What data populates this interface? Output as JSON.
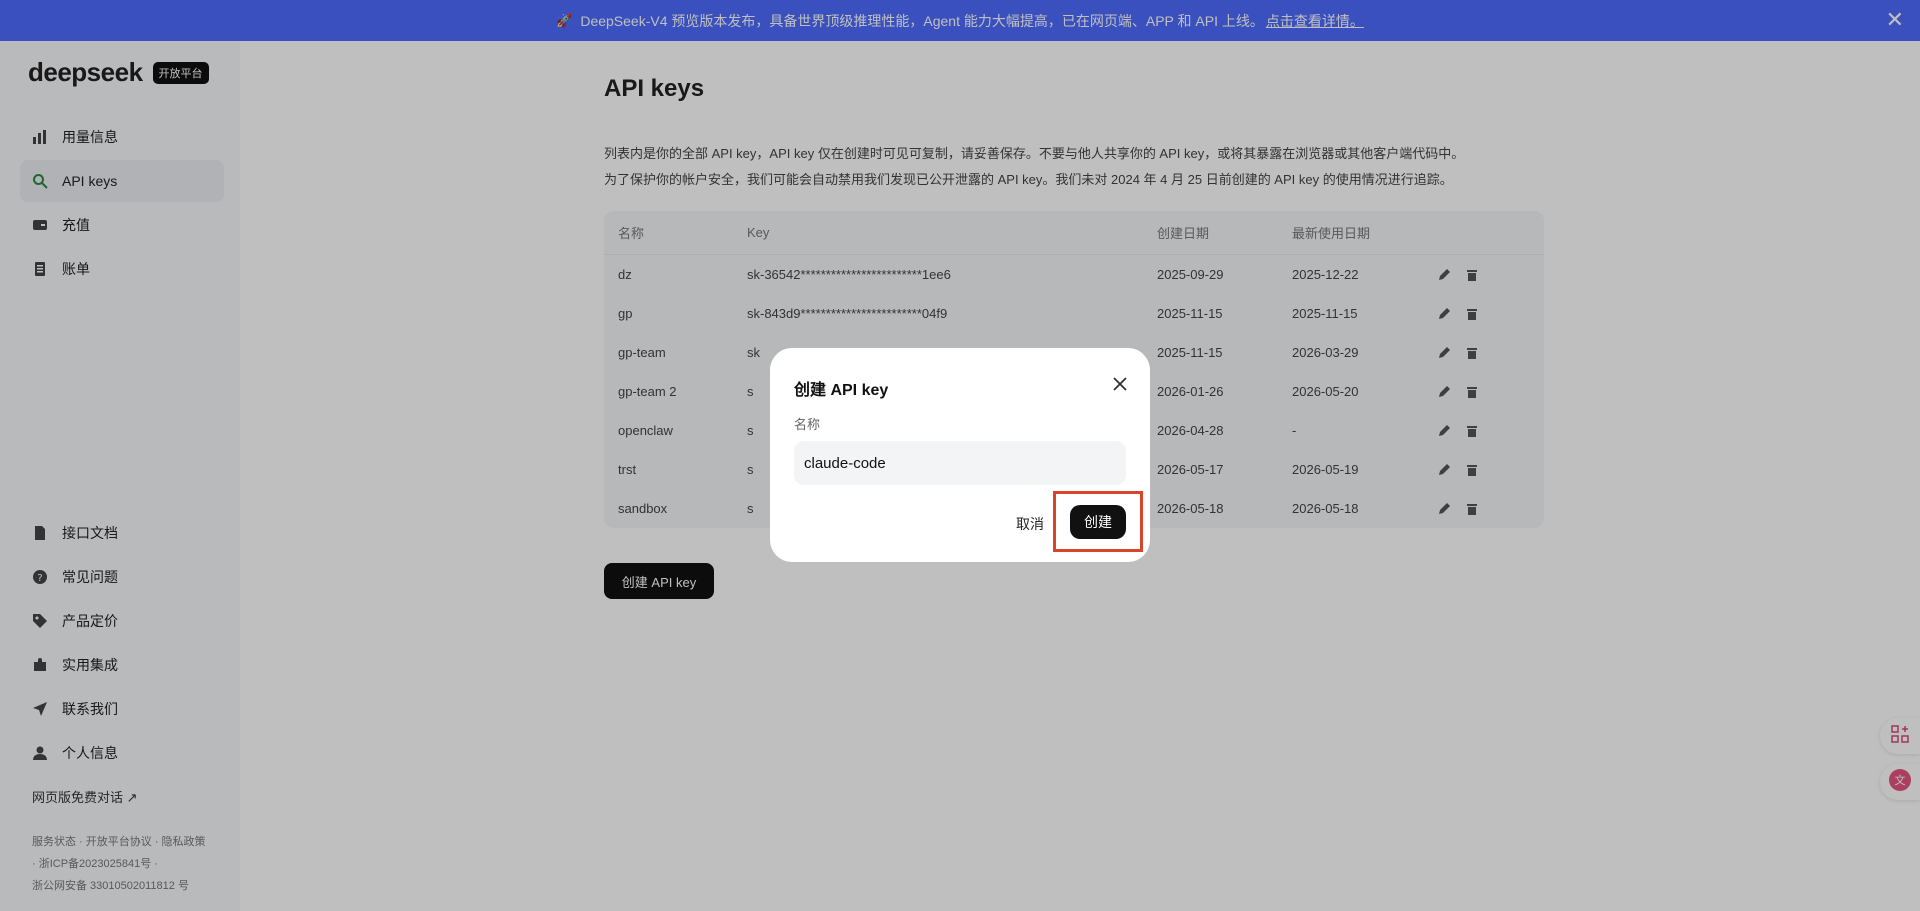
{
  "banner": {
    "text": "DeepSeek-V4 预览版本发布，具备世界顶级推理性能，Agent 能力大幅提高，已在网页端、APP 和 API 上线。",
    "link": "点击查看详情。",
    "close": "✕"
  },
  "sidebar": {
    "logo": "deepseek",
    "badge": "开放平台",
    "items": [
      {
        "label": "用量信息",
        "icon": "bar-chart-icon"
      },
      {
        "label": "API keys",
        "icon": "search-icon"
      },
      {
        "label": "充值",
        "icon": "wallet-icon"
      },
      {
        "label": "账单",
        "icon": "receipt-icon"
      }
    ],
    "bottom_items": [
      {
        "label": "接口文档",
        "icon": "document-icon"
      },
      {
        "label": "常见问题",
        "icon": "help-icon"
      },
      {
        "label": "产品定价",
        "icon": "tag-icon"
      },
      {
        "label": "实用集成",
        "icon": "puzzle-icon"
      },
      {
        "label": "联系我们",
        "icon": "send-icon"
      },
      {
        "label": "个人信息",
        "icon": "user-icon"
      }
    ],
    "web_chat": "网页版免费对话 ↗",
    "footer_1": "服务状态 · 开放平台协议 · 隐私政策",
    "footer_2": "· 浙ICP备2023025841号 ·",
    "footer_3": "浙公网安备 33010502011812 号"
  },
  "main": {
    "title": "API keys",
    "desc_1": "列表内是你的全部 API key，API key 仅在创建时可见可复制，请妥善保存。不要与他人共享你的 API key，或将其暴露在浏览器或其他客户端代码中。",
    "desc_2": "为了保护你的帐户安全，我们可能会自动禁用我们发现已公开泄露的 API key。我们未对 2024 年 4 月 25 日前创建的 API key 的使用情况进行追踪。",
    "table": {
      "headers": [
        "名称",
        "Key",
        "创建日期",
        "最新使用日期"
      ],
      "rows": [
        {
          "name": "dz",
          "key": "sk-36542************************1ee6",
          "created": "2025-09-29",
          "used": "2025-12-22"
        },
        {
          "name": "gp",
          "key": "sk-843d9************************04f9",
          "created": "2025-11-15",
          "used": "2025-11-15"
        },
        {
          "name": "gp-team",
          "key": "sk",
          "created": "2025-11-15",
          "used": "2026-03-29"
        },
        {
          "name": "gp-team 2",
          "key": "s",
          "created": "2026-01-26",
          "used": "2026-05-20"
        },
        {
          "name": "openclaw",
          "key": "s",
          "created": "2026-04-28",
          "used": "-"
        },
        {
          "name": "trst",
          "key": "s",
          "created": "2026-05-17",
          "used": "2026-05-19"
        },
        {
          "name": "sandbox",
          "key": "s",
          "created": "2026-05-18",
          "used": "2026-05-18"
        }
      ]
    },
    "create_button": "创建 API key"
  },
  "modal": {
    "title": "创建 API key",
    "label": "名称",
    "input_value": "claude-code",
    "cancel": "取消",
    "confirm": "创建"
  }
}
